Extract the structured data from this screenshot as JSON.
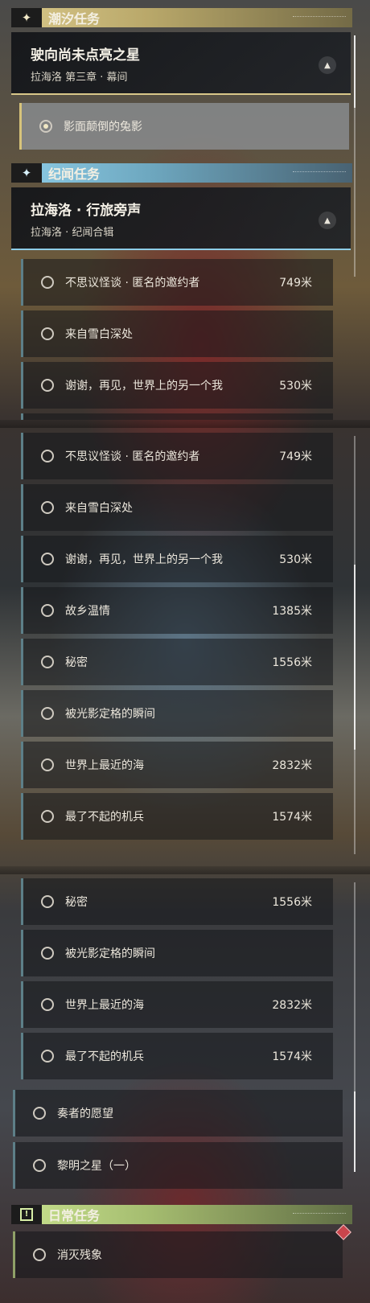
{
  "colors": {
    "tide_accent": "#d8c789",
    "chronicle_accent": "#8ecde7",
    "daily_accent": "#c9e28f",
    "active_border": "#d7c37a",
    "row_border": "#5d7f88"
  },
  "categories": {
    "tide": {
      "label": "潮汐任务",
      "icon": "sparkle-icon"
    },
    "chronicle": {
      "label": "纪闻任务",
      "icon": "sparkle-icon"
    },
    "daily": {
      "label": "日常任务",
      "icon": "exclamation-icon"
    }
  },
  "tide_card": {
    "title": "驶向尚未点亮之星",
    "subtitle": "拉海洛 第三章 · 幕间"
  },
  "tide_quest": {
    "label": "影面颠倒的兔影",
    "state": "tracked"
  },
  "chronicle_card": {
    "title": "拉海洛 · 行旅旁声",
    "subtitle": "拉海洛 · 纪闻合辑"
  },
  "quests": [
    {
      "name": "不思议怪谈 · 匿名的邀约者",
      "distance": "749米"
    },
    {
      "name": "来自雪白深处",
      "distance": ""
    },
    {
      "name": "谢谢，再见，世界上的另一个我",
      "distance": "530米"
    },
    {
      "name": "故乡温情",
      "distance": "1385米"
    },
    {
      "name": "秘密",
      "distance": "1556米"
    },
    {
      "name": "被光影定格的瞬间",
      "distance": ""
    },
    {
      "name": "世界上最近的海",
      "distance": "2832米"
    },
    {
      "name": "最了不起的机兵",
      "distance": "1574米"
    },
    {
      "name": "奏者的愿望",
      "distance": ""
    },
    {
      "name": "黎明之星（一）",
      "distance": ""
    }
  ],
  "daily_quests": [
    {
      "name": "消灭残象",
      "distance": ""
    }
  ]
}
